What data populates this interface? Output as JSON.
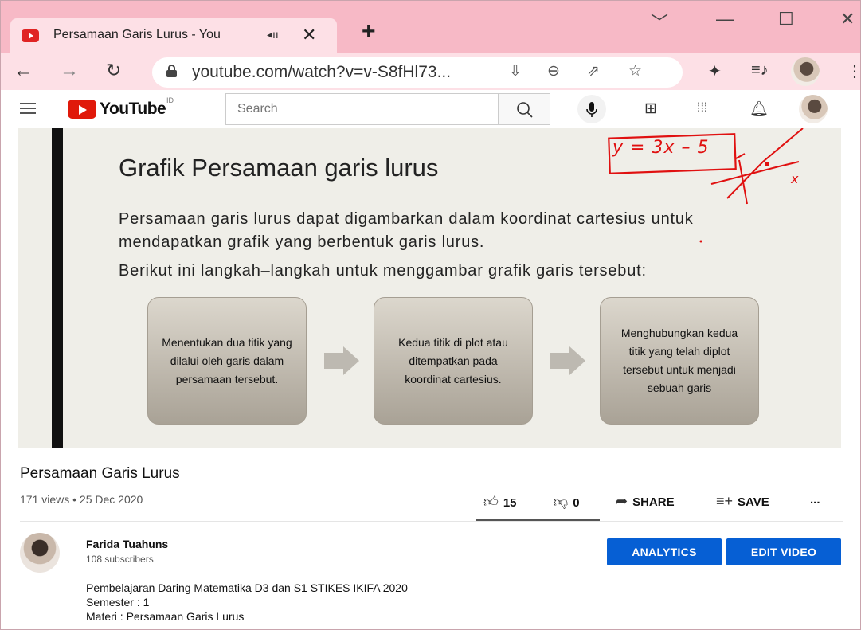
{
  "browser": {
    "tab_title": "Persamaan Garis Lurus - YouTube",
    "tab_title_visible": "Persamaan Garis Lurus - You",
    "url": "youtube.com/watch?v=v-S8fHl73..."
  },
  "youtube": {
    "logo_text": "YouTube",
    "region": "ID",
    "search_placeholder": "Search"
  },
  "slide": {
    "title": "Grafik Persamaan garis lurus",
    "paragraph1": "Persamaan garis lurus dapat digambarkan dalam koordinat cartesius untuk mendapatkan grafik yang berbentuk garis lurus.",
    "paragraph2": "Berikut ini langkah–langkah untuk menggambar grafik garis tersebut:",
    "steps": [
      "Menentukan dua titik yang dilalui oleh garis dalam persamaan tersebut.",
      "Kedua titik di plot atau ditempatkan pada koordinat cartesius.",
      "Menghubungkan kedua titik yang telah diplot tersebut untuk menjadi sebuah garis"
    ],
    "annotation": "y = 3x – 5",
    "annotation_x": "x"
  },
  "video": {
    "title": "Persamaan Garis Lurus",
    "meta": "171 views • 25 Dec 2020",
    "likes": "15",
    "dislikes": "0",
    "share_label": "SHARE",
    "save_label": "SAVE",
    "more_label": "..."
  },
  "channel": {
    "name": "Farida Tuahuns",
    "subscribers": "108 subscribers",
    "analytics_label": "ANALYTICS",
    "edit_label": "EDIT VIDEO"
  },
  "description": {
    "line1": "Pembelajaran Daring Matematika D3 dan S1 STIKES IKIFA 2020",
    "line2": "Semester : 1",
    "line3": "Materi : Persamaan Garis Lurus"
  },
  "colors": {
    "titlebar": "#f7b9c6",
    "toolbar": "#fde0e6",
    "accent": "#065fd4",
    "annotation": "#e01010"
  }
}
